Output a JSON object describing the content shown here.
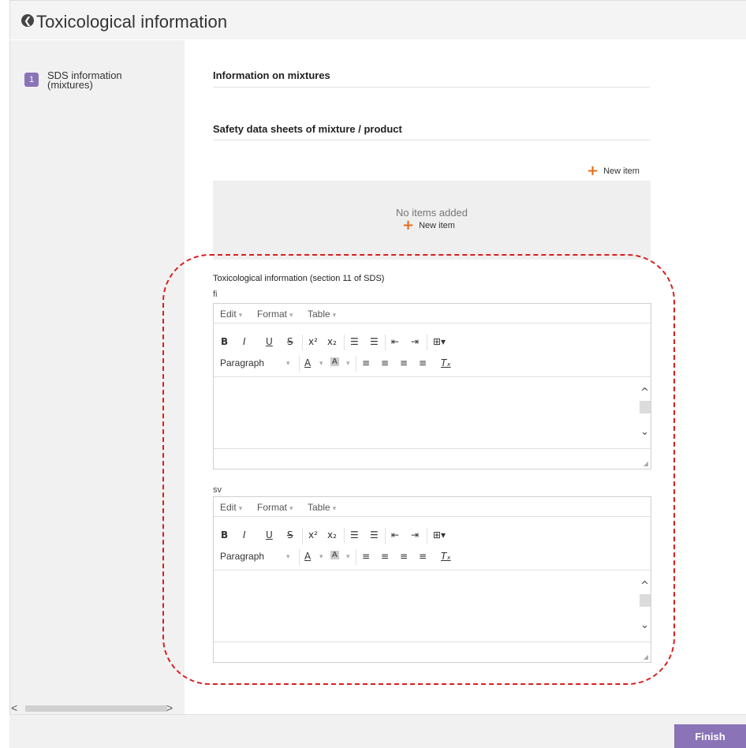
{
  "header": {
    "title": "Toxicological information",
    "back_icon": "circle-chevron-left"
  },
  "sidebar": {
    "steps": [
      {
        "number": "1",
        "label": "SDS information (mixtures)"
      }
    ]
  },
  "main": {
    "section1_title": "Information on mixtures",
    "section2_title": "Safety data sheets of mixture / product",
    "new_item_label": "New item",
    "empty_text": "No items added",
    "tox_label": "Toxicological information (section 11 of SDS)",
    "editors": [
      {
        "lang": "fi",
        "menus": [
          "Edit",
          "Format",
          "Table"
        ],
        "paragraph": "Paragraph"
      },
      {
        "lang": "sv",
        "menus": [
          "Edit",
          "Format",
          "Table"
        ],
        "paragraph": "Paragraph"
      }
    ]
  },
  "footer": {
    "finish_label": "Finish"
  },
  "colors": {
    "accent": "#8a74b7",
    "plus": "#e66b1b",
    "highlight": "#d81f1f"
  }
}
